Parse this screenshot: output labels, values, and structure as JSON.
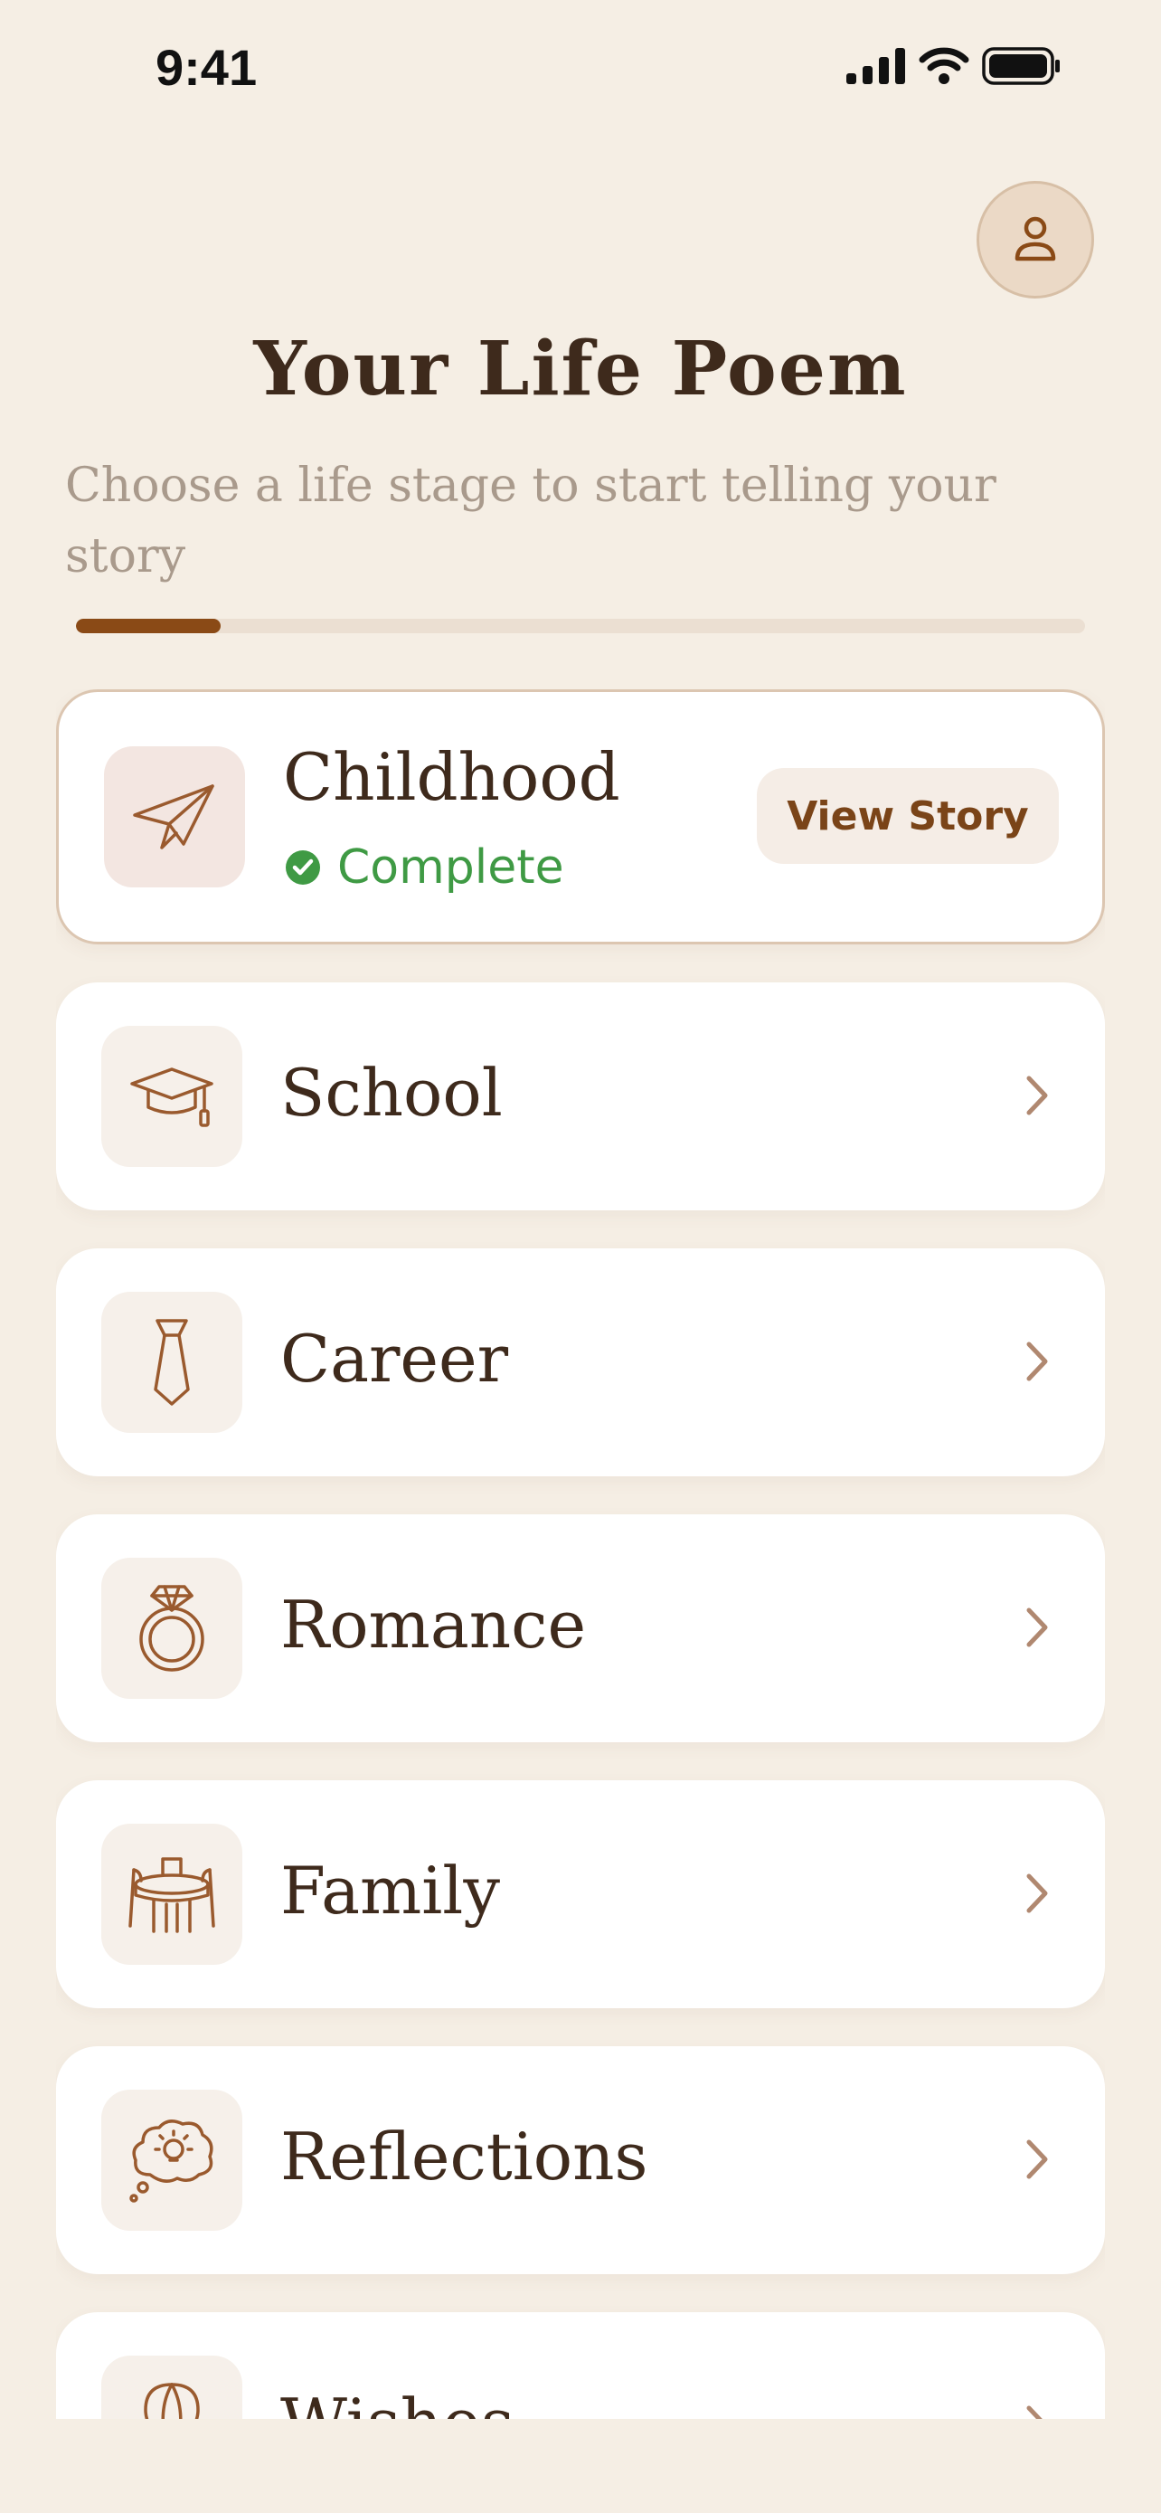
{
  "status_bar": {
    "time": "9:41"
  },
  "header": {
    "title": "Your Life Poem",
    "subtitle": "Choose a life stage to start telling your story",
    "progress": 0.143
  },
  "stages": [
    {
      "label": "Childhood",
      "icon": "paper-plane-icon",
      "status": "Complete",
      "action": "View Story"
    },
    {
      "label": "School",
      "icon": "graduation-cap-icon"
    },
    {
      "label": "Career",
      "icon": "necktie-icon"
    },
    {
      "label": "Romance",
      "icon": "diamond-ring-icon"
    },
    {
      "label": "Family",
      "icon": "dining-table-icon"
    },
    {
      "label": "Reflections",
      "icon": "thought-bubble-icon"
    },
    {
      "label": "Wishes",
      "icon": "hot-air-balloon-icon"
    }
  ],
  "colors": {
    "background": "#F5EEE4",
    "accent": "#8A4A16",
    "text": "#3E2A1C",
    "success": "#3F9A44"
  }
}
